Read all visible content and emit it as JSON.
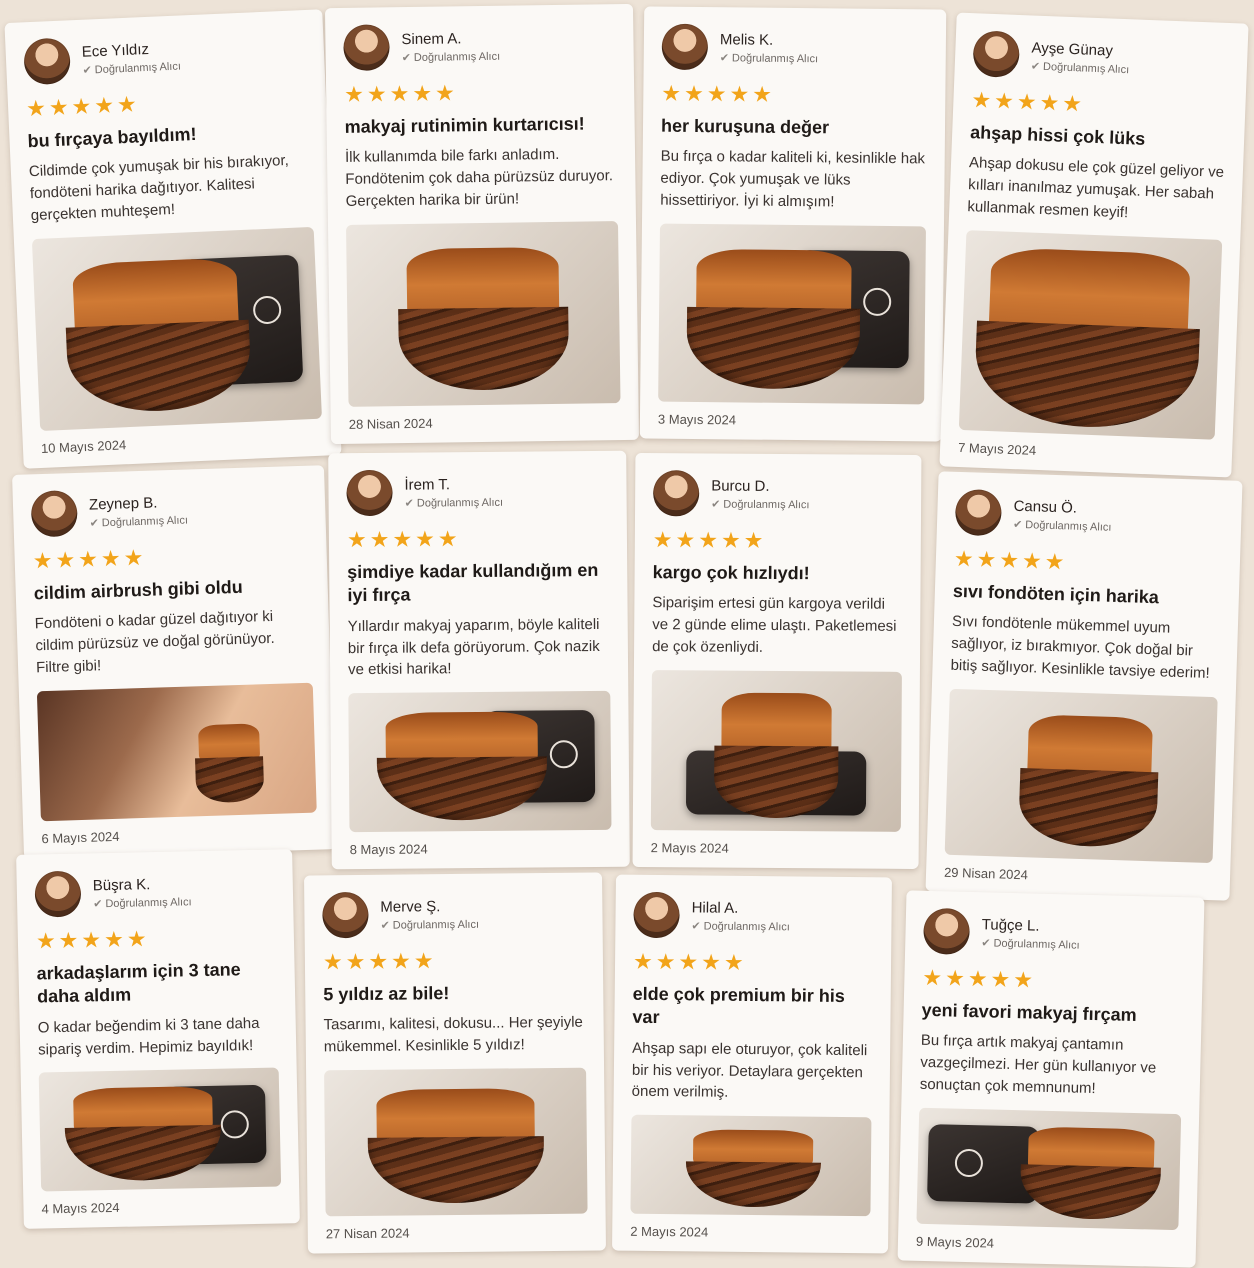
{
  "verified_label": "Doğrulanmış Alıcı",
  "stars": "★★★★★",
  "reviews": [
    {
      "name": "Ece Yıldız",
      "title": "bu fırçaya bayıldım!",
      "body": "Cildimde çok yumuşak bir his bırakıyor, fondöteni harika dağıtıyor. Kalitesi gerçekten muhteşem!",
      "date": "10 Mayıs 2024",
      "photo": "brush-with-case"
    },
    {
      "name": "Sinem A.",
      "title": "makyaj rutinimin kurtarıcısı!",
      "body": "İlk kullanımda bile farkı anladım. Fondötenim çok daha pürüzsüz duruyor. Gerçekten harika bir ürün!",
      "date": "28 Nisan 2024",
      "photo": "brush-only"
    },
    {
      "name": "Melis K.",
      "title": "her kuruşuna değer",
      "body": "Bu fırça o kadar kaliteli ki, kesinlikle hak ediyor. Çok yumuşak ve lüks hissettiriyor. İyi ki almışım!",
      "date": "3 Mayıs 2024",
      "photo": "brush-with-case"
    },
    {
      "name": "Ayşe Günay",
      "title": "ahşap hissi çok lüks",
      "body": "Ahşap dokusu ele çok güzel geliyor ve kılları inanılmaz yumuşak. Her sabah kullanmak resmen keyif!",
      "date": "7 Mayıs 2024",
      "photo": "brush-only"
    },
    {
      "name": "Zeynep B.",
      "title": "cildim airbrush gibi oldu",
      "body": "Fondöteni o kadar güzel dağıtıyor ki cildim pürüzsüz ve doğal görünüyor. Filtre gibi!",
      "date": "6 Mayıs 2024",
      "photo": "face"
    },
    {
      "name": "İrem T.",
      "title": "şimdiye kadar kullandığım en iyi fırça",
      "body": "Yıllardır makyaj yaparım, böyle kaliteli bir fırça ilk defa görüyorum. Çok nazik ve etkisi harika!",
      "date": "8 Mayıs 2024",
      "photo": "brush-with-case"
    },
    {
      "name": "Burcu D.",
      "title": "kargo çok hızlıydı!",
      "body": "Siparişim ertesi gün kargoya verildi ve 2 günde elime ulaştı. Paketlemesi de çok özenliydi.",
      "date": "2 Mayıs 2024",
      "photo": "brush-with-case"
    },
    {
      "name": "Cansu Ö.",
      "title": "sıvı fondöten için harika",
      "body": "Sıvı fondötenle mükemmel uyum sağlıyor, iz bırakmıyor. Çok doğal bir bitiş sağlıyor. Kesinlikle tavsiye ederim!",
      "date": "29 Nisan 2024",
      "photo": "brush-only"
    },
    {
      "name": "Büşra K.",
      "title": "arkadaşlarım için 3 tane daha aldım",
      "body": "O kadar beğendim ki 3 tane daha sipariş verdim. Hepimiz bayıldık!",
      "date": "4 Mayıs 2024",
      "photo": "brush-with-case"
    },
    {
      "name": "Merve Ş.",
      "title": "5 yıldız az bile!",
      "body": "Tasarımı, kalitesi, dokusu... Her şeyiyle mükemmel. Kesinlikle 5 yıldız!",
      "date": "27 Nisan 2024",
      "photo": "brush-only"
    },
    {
      "name": "Hilal A.",
      "title": "elde çok premium bir his var",
      "body": "Ahşap sapı ele oturuyor, çok kaliteli bir his veriyor. Detaylara gerçekten önem verilmiş.",
      "date": "2 Mayıs 2024",
      "photo": "brush-only"
    },
    {
      "name": "Tuğçe L.",
      "title": "yeni favori makyaj fırçam",
      "body": "Bu fırça artık makyaj çantamın vazgeçilmezi. Her gün kullanıyor ve sonuçtan çok memnunum!",
      "date": "9 Mayıs 2024",
      "photo": "brush-with-case"
    }
  ]
}
